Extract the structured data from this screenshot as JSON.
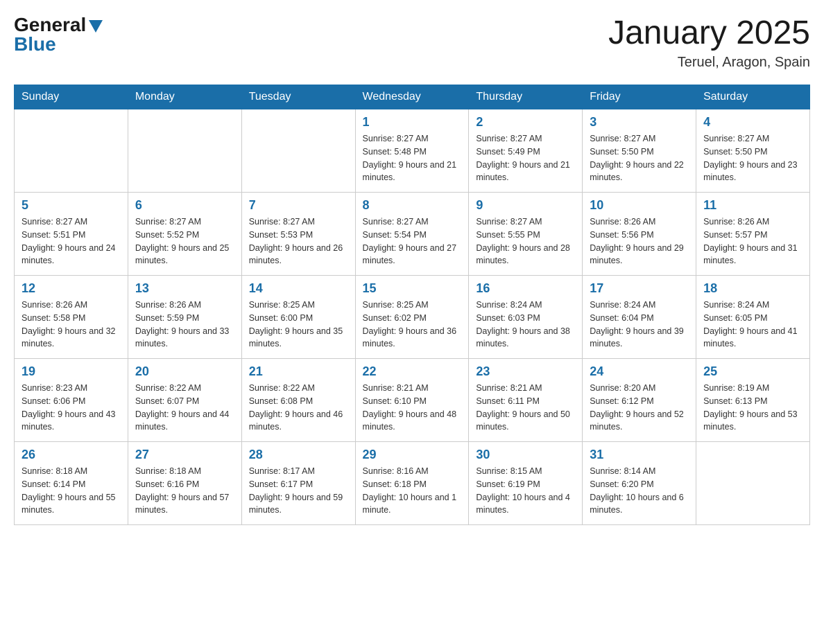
{
  "header": {
    "logo_general": "General",
    "logo_blue": "Blue",
    "title": "January 2025",
    "subtitle": "Teruel, Aragon, Spain"
  },
  "days_of_week": [
    "Sunday",
    "Monday",
    "Tuesday",
    "Wednesday",
    "Thursday",
    "Friday",
    "Saturday"
  ],
  "weeks": [
    [
      {
        "day": "",
        "info": ""
      },
      {
        "day": "",
        "info": ""
      },
      {
        "day": "",
        "info": ""
      },
      {
        "day": "1",
        "info": "Sunrise: 8:27 AM\nSunset: 5:48 PM\nDaylight: 9 hours and 21 minutes."
      },
      {
        "day": "2",
        "info": "Sunrise: 8:27 AM\nSunset: 5:49 PM\nDaylight: 9 hours and 21 minutes."
      },
      {
        "day": "3",
        "info": "Sunrise: 8:27 AM\nSunset: 5:50 PM\nDaylight: 9 hours and 22 minutes."
      },
      {
        "day": "4",
        "info": "Sunrise: 8:27 AM\nSunset: 5:50 PM\nDaylight: 9 hours and 23 minutes."
      }
    ],
    [
      {
        "day": "5",
        "info": "Sunrise: 8:27 AM\nSunset: 5:51 PM\nDaylight: 9 hours and 24 minutes."
      },
      {
        "day": "6",
        "info": "Sunrise: 8:27 AM\nSunset: 5:52 PM\nDaylight: 9 hours and 25 minutes."
      },
      {
        "day": "7",
        "info": "Sunrise: 8:27 AM\nSunset: 5:53 PM\nDaylight: 9 hours and 26 minutes."
      },
      {
        "day": "8",
        "info": "Sunrise: 8:27 AM\nSunset: 5:54 PM\nDaylight: 9 hours and 27 minutes."
      },
      {
        "day": "9",
        "info": "Sunrise: 8:27 AM\nSunset: 5:55 PM\nDaylight: 9 hours and 28 minutes."
      },
      {
        "day": "10",
        "info": "Sunrise: 8:26 AM\nSunset: 5:56 PM\nDaylight: 9 hours and 29 minutes."
      },
      {
        "day": "11",
        "info": "Sunrise: 8:26 AM\nSunset: 5:57 PM\nDaylight: 9 hours and 31 minutes."
      }
    ],
    [
      {
        "day": "12",
        "info": "Sunrise: 8:26 AM\nSunset: 5:58 PM\nDaylight: 9 hours and 32 minutes."
      },
      {
        "day": "13",
        "info": "Sunrise: 8:26 AM\nSunset: 5:59 PM\nDaylight: 9 hours and 33 minutes."
      },
      {
        "day": "14",
        "info": "Sunrise: 8:25 AM\nSunset: 6:00 PM\nDaylight: 9 hours and 35 minutes."
      },
      {
        "day": "15",
        "info": "Sunrise: 8:25 AM\nSunset: 6:02 PM\nDaylight: 9 hours and 36 minutes."
      },
      {
        "day": "16",
        "info": "Sunrise: 8:24 AM\nSunset: 6:03 PM\nDaylight: 9 hours and 38 minutes."
      },
      {
        "day": "17",
        "info": "Sunrise: 8:24 AM\nSunset: 6:04 PM\nDaylight: 9 hours and 39 minutes."
      },
      {
        "day": "18",
        "info": "Sunrise: 8:24 AM\nSunset: 6:05 PM\nDaylight: 9 hours and 41 minutes."
      }
    ],
    [
      {
        "day": "19",
        "info": "Sunrise: 8:23 AM\nSunset: 6:06 PM\nDaylight: 9 hours and 43 minutes."
      },
      {
        "day": "20",
        "info": "Sunrise: 8:22 AM\nSunset: 6:07 PM\nDaylight: 9 hours and 44 minutes."
      },
      {
        "day": "21",
        "info": "Sunrise: 8:22 AM\nSunset: 6:08 PM\nDaylight: 9 hours and 46 minutes."
      },
      {
        "day": "22",
        "info": "Sunrise: 8:21 AM\nSunset: 6:10 PM\nDaylight: 9 hours and 48 minutes."
      },
      {
        "day": "23",
        "info": "Sunrise: 8:21 AM\nSunset: 6:11 PM\nDaylight: 9 hours and 50 minutes."
      },
      {
        "day": "24",
        "info": "Sunrise: 8:20 AM\nSunset: 6:12 PM\nDaylight: 9 hours and 52 minutes."
      },
      {
        "day": "25",
        "info": "Sunrise: 8:19 AM\nSunset: 6:13 PM\nDaylight: 9 hours and 53 minutes."
      }
    ],
    [
      {
        "day": "26",
        "info": "Sunrise: 8:18 AM\nSunset: 6:14 PM\nDaylight: 9 hours and 55 minutes."
      },
      {
        "day": "27",
        "info": "Sunrise: 8:18 AM\nSunset: 6:16 PM\nDaylight: 9 hours and 57 minutes."
      },
      {
        "day": "28",
        "info": "Sunrise: 8:17 AM\nSunset: 6:17 PM\nDaylight: 9 hours and 59 minutes."
      },
      {
        "day": "29",
        "info": "Sunrise: 8:16 AM\nSunset: 6:18 PM\nDaylight: 10 hours and 1 minute."
      },
      {
        "day": "30",
        "info": "Sunrise: 8:15 AM\nSunset: 6:19 PM\nDaylight: 10 hours and 4 minutes."
      },
      {
        "day": "31",
        "info": "Sunrise: 8:14 AM\nSunset: 6:20 PM\nDaylight: 10 hours and 6 minutes."
      },
      {
        "day": "",
        "info": ""
      }
    ]
  ]
}
